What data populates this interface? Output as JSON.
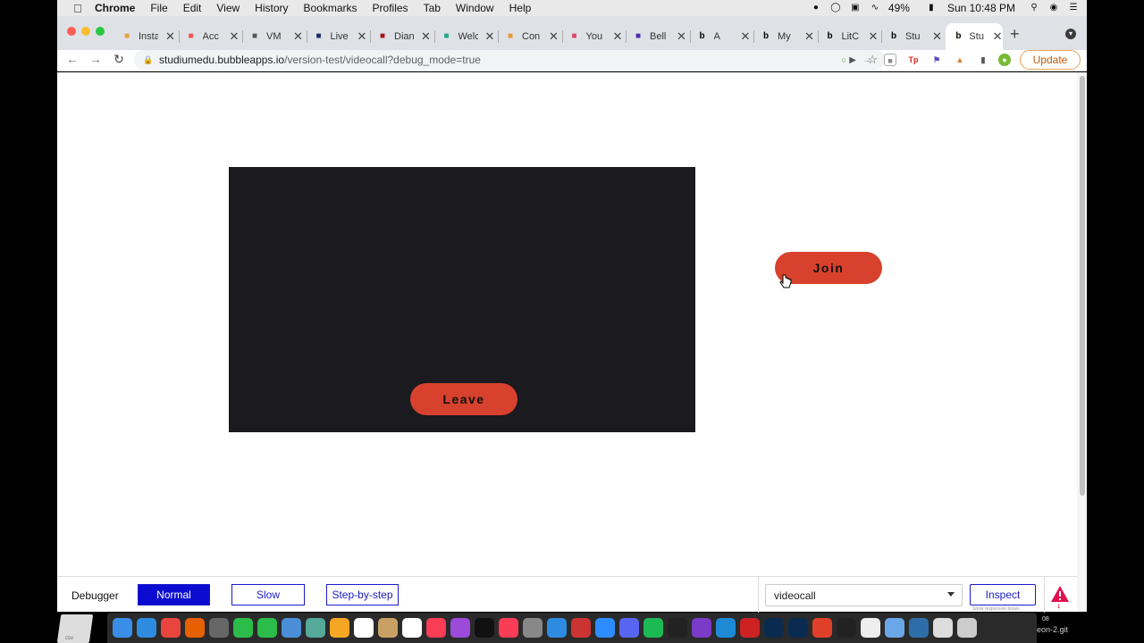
{
  "menubar": {
    "app_name": "Chrome",
    "items": [
      "File",
      "Edit",
      "View",
      "History",
      "Bookmarks",
      "Profiles",
      "Tab",
      "Window",
      "Help"
    ],
    "battery": "49%",
    "clock": "Sun 10:48 PM"
  },
  "tabs": [
    {
      "label": "Insta",
      "favicon": "box-icon",
      "color": "#e6a23c"
    },
    {
      "label": "Acc",
      "favicon": "infinity-icon",
      "color": "#e55"
    },
    {
      "label": "VM",
      "favicon": "gear-icon",
      "color": "#555"
    },
    {
      "label": "Live",
      "favicon": "l-icon",
      "color": "#1a2a6c"
    },
    {
      "label": "Dian",
      "favicon": "heart-icon",
      "color": "#a4141c"
    },
    {
      "label": "Welc",
      "favicon": "lock-icon",
      "color": "#2a8"
    },
    {
      "label": "Con",
      "favicon": "flower-icon",
      "color": "#e8952c"
    },
    {
      "label": "You",
      "favicon": "wave-icon",
      "color": "#e0466b"
    },
    {
      "label": "Bell",
      "favicon": "bell-icon",
      "color": "#4b2bb1"
    },
    {
      "label": "A",
      "favicon": "b-icon",
      "color": "#000"
    },
    {
      "label": "My",
      "favicon": "b-icon",
      "color": "#000"
    },
    {
      "label": "LitC",
      "favicon": "b-icon",
      "color": "#000"
    },
    {
      "label": "Stu",
      "favicon": "b-icon",
      "color": "#000"
    },
    {
      "label": "Stu",
      "favicon": "b-icon",
      "color": "#000",
      "active": true
    }
  ],
  "address": {
    "host": "studiumedu.bubbleapps.io",
    "path": "/version-test/videocall?debug_mode=true"
  },
  "toolbar": {
    "update_label": "Update"
  },
  "page": {
    "leave_label": "Leave",
    "join_label": "Join"
  },
  "debugger": {
    "label": "Debugger",
    "modes": [
      "Normal",
      "Slow",
      "Step-by-step"
    ],
    "active_mode": "Normal",
    "page_selected": "videocall",
    "inspect_label": "Inspect",
    "inspect_sub": "Show responsive boxes",
    "warning_count": "1"
  },
  "dock": {
    "left_label": "csv",
    "right_label": "eon-2.git",
    "right_num": "08"
  },
  "colors": {
    "button_red": "#d7412d",
    "video_bg": "#1b1a1e",
    "debug_blue": "#0b0bd1"
  }
}
